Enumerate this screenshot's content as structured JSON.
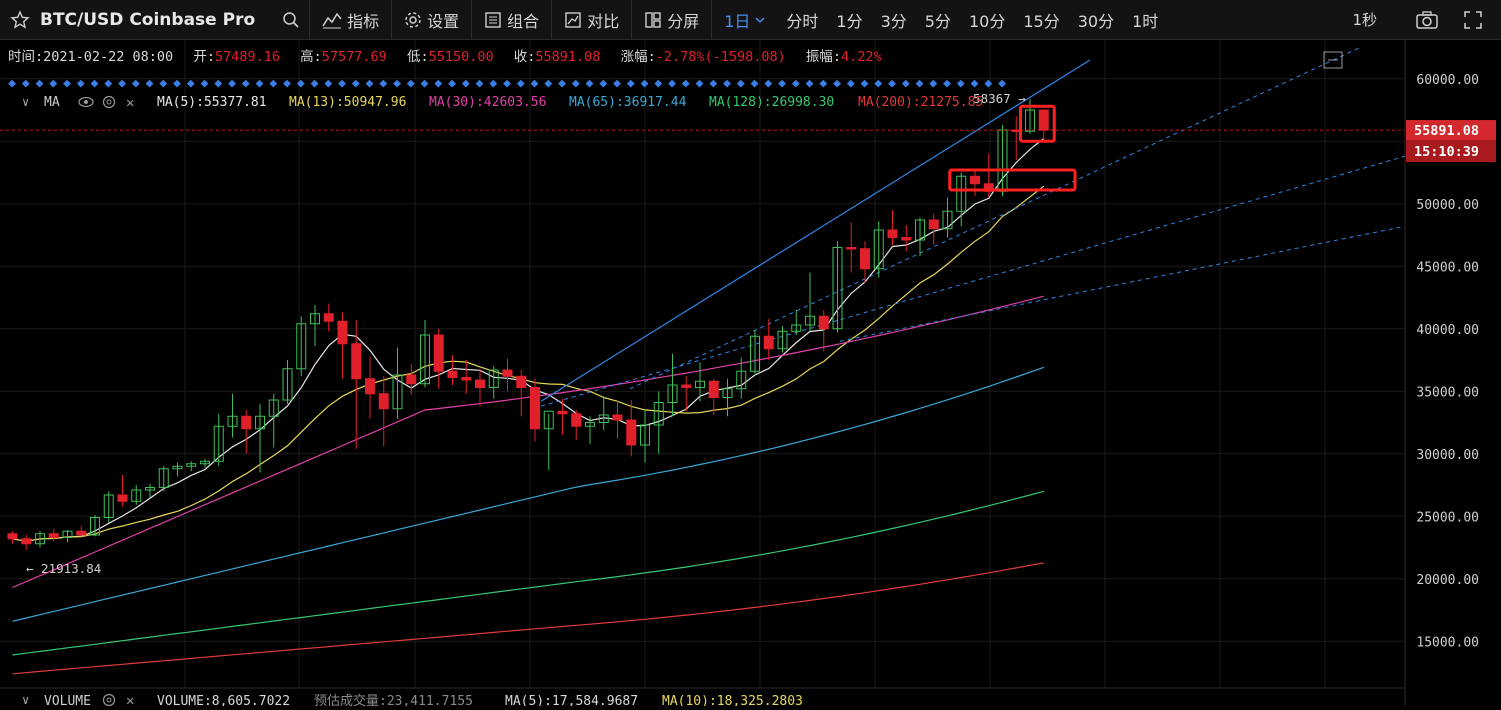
{
  "toolbar": {
    "symbol": "BTC/USD Coinbase Pro",
    "indicators": "指标",
    "settings": "设置",
    "layout": "组合",
    "compare": "对比",
    "split": "分屏",
    "timeframe_active": "1日",
    "timeframes": [
      "分时",
      "1分",
      "3分",
      "5分",
      "10分",
      "15分",
      "30分",
      "1时"
    ],
    "refresh": "1秒"
  },
  "ohlc_line": {
    "time_label": "时间:",
    "time": "2021-02-22 08:00",
    "open_label": "开:",
    "open": "57489.16",
    "high_label": "高:",
    "high": "57577.69",
    "low_label": "低:",
    "low": "55150.00",
    "close_label": "收:",
    "close": "55891.08",
    "change_label": "涨幅:",
    "change": "-2.78%(-1598.08)",
    "amp_label": "振幅:",
    "amp": "4.22%"
  },
  "ma_legend": {
    "label": "MA",
    "items": [
      {
        "text": "MA(5):55377.81",
        "color": "#e6e6e6"
      },
      {
        "text": "MA(13):50947.96",
        "color": "#e8d75a"
      },
      {
        "text": "MA(30):42603.56",
        "color": "#e040a8"
      },
      {
        "text": "MA(65):36917.44",
        "color": "#3aa8d8"
      },
      {
        "text": "MA(128):26998.30",
        "color": "#36c870"
      },
      {
        "text": "MA(200):21275.85",
        "color": "#e03a3a"
      }
    ]
  },
  "volume_legend": {
    "label": "VOLUME",
    "volume": "VOLUME:8,605.7022",
    "estimate": "预估成交量:23,411.7155",
    "ma5": "MA(5):17,584.9687",
    "ma10": "MA(10):18,325.2803"
  },
  "price_tag": "55891.08",
  "countdown": "15:10:39",
  "max_label": "58367 →",
  "min_label": "← 21913.84",
  "colors": {
    "up": "#3fbf5a",
    "down": "#e0202a",
    "marker": "#3a7ee6",
    "trend": "#2f86e8",
    "highlight": "#ff2020"
  },
  "chart_data": {
    "type": "candlestick",
    "title": "BTC/USD Coinbase Pro",
    "y_ticks": [
      60000,
      55000,
      50000,
      45000,
      40000,
      35000,
      30000,
      25000,
      20000,
      15000
    ],
    "y_range": [
      10000,
      61500
    ],
    "candles": [
      [
        23600,
        23800,
        22800,
        23200
      ],
      [
        23200,
        23500,
        22300,
        22800
      ],
      [
        22800,
        23800,
        22500,
        23600
      ],
      [
        23600,
        24000,
        23000,
        23300
      ],
      [
        23300,
        23900,
        22900,
        23800
      ],
      [
        23800,
        24200,
        23400,
        23500
      ],
      [
        23500,
        25100,
        23400,
        24900
      ],
      [
        24900,
        27000,
        24500,
        26700
      ],
      [
        26700,
        28300,
        25800,
        26200
      ],
      [
        26200,
        27500,
        25900,
        27100
      ],
      [
        27100,
        27600,
        26500,
        27300
      ],
      [
        27300,
        29000,
        27000,
        28800
      ],
      [
        28800,
        29300,
        28200,
        29000
      ],
      [
        29000,
        29400,
        28600,
        29200
      ],
      [
        29200,
        29600,
        28900,
        29400
      ],
      [
        29400,
        33200,
        29000,
        32200
      ],
      [
        32200,
        34800,
        31300,
        33000
      ],
      [
        33000,
        33500,
        30000,
        32000
      ],
      [
        32000,
        34000,
        28500,
        33000
      ],
      [
        33000,
        34800,
        30500,
        34300
      ],
      [
        34300,
        37500,
        34000,
        36800
      ],
      [
        36800,
        41000,
        36200,
        40400
      ],
      [
        40400,
        41900,
        38600,
        41200
      ],
      [
        41200,
        42000,
        39800,
        40600
      ],
      [
        40600,
        41300,
        36000,
        38800
      ],
      [
        38800,
        40700,
        30400,
        36000
      ],
      [
        36000,
        37800,
        32800,
        34800
      ],
      [
        34800,
        36200,
        30600,
        33600
      ],
      [
        33600,
        38500,
        32800,
        36300
      ],
      [
        36300,
        37200,
        34700,
        35600
      ],
      [
        35600,
        40700,
        35300,
        39500
      ],
      [
        39500,
        40000,
        35200,
        36600
      ],
      [
        36600,
        37900,
        35500,
        36100
      ],
      [
        36100,
        37500,
        34800,
        35900
      ],
      [
        35900,
        36800,
        33800,
        35300
      ],
      [
        35300,
        37000,
        34400,
        36700
      ],
      [
        36700,
        37600,
        35000,
        36200
      ],
      [
        36200,
        36700,
        33000,
        35300
      ],
      [
        35300,
        36000,
        31000,
        32000
      ],
      [
        32000,
        33200,
        28700,
        33400
      ],
      [
        33400,
        34400,
        31500,
        33200
      ],
      [
        33200,
        33500,
        31100,
        32200
      ],
      [
        32200,
        33000,
        30800,
        32500
      ],
      [
        32500,
        34600,
        31900,
        33100
      ],
      [
        33100,
        34300,
        31200,
        32700
      ],
      [
        32700,
        34300,
        29800,
        30700
      ],
      [
        30700,
        33500,
        29300,
        32300
      ],
      [
        32300,
        35000,
        30000,
        34100
      ],
      [
        34100,
        38000,
        33000,
        35500
      ],
      [
        35500,
        36200,
        33400,
        35300
      ],
      [
        35300,
        37300,
        34200,
        35800
      ],
      [
        35800,
        36000,
        33100,
        34500
      ],
      [
        34500,
        36000,
        33000,
        35200
      ],
      [
        35200,
        37700,
        34400,
        36600
      ],
      [
        36600,
        39900,
        36300,
        39400
      ],
      [
        39400,
        40800,
        37500,
        38400
      ],
      [
        38400,
        40200,
        38100,
        39800
      ],
      [
        39800,
        41500,
        39500,
        40300
      ],
      [
        40300,
        44500,
        39800,
        41000
      ],
      [
        41000,
        41500,
        38200,
        40000
      ],
      [
        40000,
        47000,
        39700,
        46500
      ],
      [
        46500,
        48500,
        44500,
        46400
      ],
      [
        46400,
        47000,
        43700,
        44800
      ],
      [
        44800,
        48600,
        44100,
        47900
      ],
      [
        47900,
        49500,
        46700,
        47300
      ],
      [
        47300,
        48300,
        46200,
        47100
      ],
      [
        47100,
        48900,
        45800,
        48700
      ],
      [
        48700,
        49200,
        46700,
        48000
      ],
      [
        48000,
        50500,
        47300,
        49400
      ],
      [
        49400,
        52500,
        48200,
        52200
      ],
      [
        52200,
        52600,
        50600,
        51600
      ],
      [
        51600,
        54000,
        50500,
        51000
      ],
      [
        51000,
        56300,
        50600,
        55900
      ],
      [
        55900,
        57000,
        53500,
        55800
      ],
      [
        55800,
        58367,
        55600,
        57500
      ],
      [
        57489.16,
        57577.69,
        55150,
        55891.08
      ]
    ],
    "ma_end_values": {
      "MA5": 55377.81,
      "MA13": 50947.96,
      "MA30": 42603.56,
      "MA65": 36917.44,
      "MA128": 26998.3,
      "MA200": 21275.85
    }
  }
}
